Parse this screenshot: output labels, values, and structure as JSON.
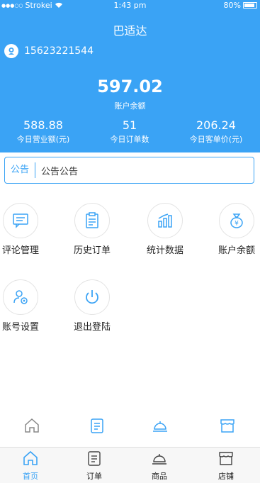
{
  "status_bar": {
    "carrier": "Strokei",
    "time": "1:43 pm",
    "battery": "80%"
  },
  "header": {
    "title": "巴适达",
    "phone": "15623221544",
    "balance": {
      "value": "597.02",
      "label": "账户余额"
    },
    "stats": [
      {
        "value": "588.88",
        "label": "今日营业额(元)"
      },
      {
        "value": "51",
        "label": "今日订单数"
      },
      {
        "value": "206.24",
        "label": "今日客单价(元)"
      }
    ]
  },
  "notice": {
    "tag": "公告",
    "text": "公告公告"
  },
  "menu": [
    {
      "label": "评论管理",
      "icon": "comment-icon"
    },
    {
      "label": "历史订单",
      "icon": "history-order-icon"
    },
    {
      "label": "统计数据",
      "icon": "statistics-icon"
    },
    {
      "label": "账户余额",
      "icon": "money-bag-icon"
    },
    {
      "label": "账号设置",
      "icon": "account-settings-icon"
    },
    {
      "label": "退出登陆",
      "icon": "power-icon"
    }
  ],
  "tabbar": [
    {
      "label": "首页",
      "icon": "home-icon",
      "active": true
    },
    {
      "label": "订单",
      "icon": "order-icon",
      "active": false
    },
    {
      "label": "商品",
      "icon": "dish-bell-icon",
      "active": false
    },
    {
      "label": "店铺",
      "icon": "shop-icon",
      "active": false
    }
  ],
  "colors": {
    "accent": "#3aa3f5",
    "header_bg": "#3aa3f5",
    "text": "#222222"
  }
}
